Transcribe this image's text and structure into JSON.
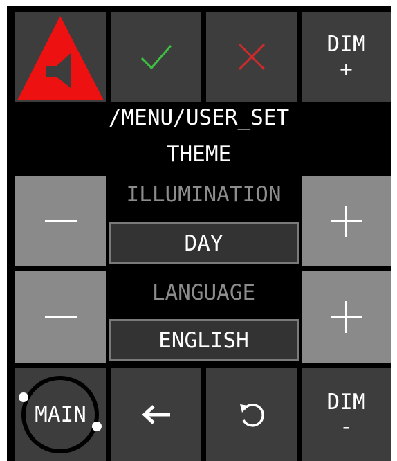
{
  "top_row": {
    "alert_icon": "speaker-warning-icon",
    "confirm_icon": "checkmark-icon",
    "cancel_icon": "x-icon",
    "dim_up": {
      "line1": "DIM",
      "line2": "+"
    }
  },
  "header": {
    "path": "/MENU/USER_SET",
    "title": "THEME"
  },
  "illumination": {
    "label": "ILLUMINATION",
    "value": "DAY",
    "minus_icon": "minus-icon",
    "plus_icon": "plus-icon"
  },
  "language": {
    "label": "LANGUAGE",
    "value": "ENGLISH",
    "minus_icon": "minus-icon",
    "plus_icon": "plus-icon"
  },
  "bottom_row": {
    "main_label": "MAIN",
    "back_icon": "arrow-left-icon",
    "reset_icon": "rotate-ccw-icon",
    "dim_down": {
      "line1": "DIM",
      "line2": "-"
    }
  },
  "colors": {
    "alert": "#ee1111",
    "confirm": "#3fbf3f",
    "cancel": "#d02a2a",
    "dark_button": "#3d3d3d",
    "light_button": "#8a8a8a",
    "label_gray": "#8c8c8c"
  }
}
